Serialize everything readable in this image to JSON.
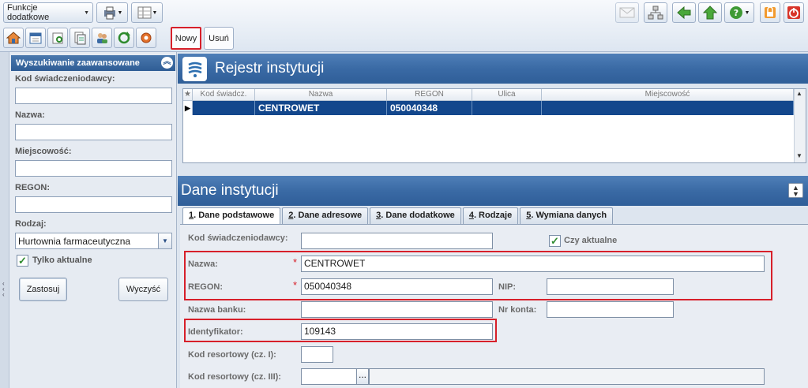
{
  "toolbar": {
    "functions_label": "Funkcje dodatkowe",
    "new_label": "Nowy",
    "delete_label": "Usuń"
  },
  "search": {
    "header": "Wyszukiwanie zaawansowane",
    "provider_code_label": "Kod świadczeniodawcy:",
    "provider_code_value": "",
    "name_label": "Nazwa:",
    "name_value": "",
    "city_label": "Miejscowość:",
    "city_value": "",
    "regon_label": "REGON:",
    "regon_value": "",
    "type_label": "Rodzaj:",
    "type_value": "Hurtownia farmaceutyczna",
    "active_only_label": "Tylko aktualne",
    "active_only_checked": true,
    "apply_label": "Zastosuj",
    "clear_label": "Wyczyść"
  },
  "registry": {
    "title": "Rejestr instytucji",
    "columns": [
      "Kod świadcz.",
      "Nazwa",
      "REGON",
      "Ulica",
      "Miejscowość"
    ],
    "rows": [
      {
        "code": "",
        "name": "CENTROWET",
        "regon": "050040348",
        "street": "",
        "city": ""
      }
    ]
  },
  "details": {
    "title": "Dane instytucji",
    "tabs": [
      {
        "num": "1",
        "label": ". Dane podstawowe"
      },
      {
        "num": "2",
        "label": ". Dane adresowe"
      },
      {
        "num": "3",
        "label": ". Dane dodatkowe"
      },
      {
        "num": "4",
        "label": ". Rodzaje"
      },
      {
        "num": "5",
        "label": ". Wymiana danych"
      }
    ],
    "provider_code_label": "Kod świadczeniodawcy:",
    "provider_code_value": "",
    "current_label": "Czy aktualne",
    "current_checked": true,
    "name_label": "Nazwa:",
    "name_value": "CENTROWET",
    "regon_label": "REGON:",
    "regon_value": "050040348",
    "nip_label": "NIP:",
    "nip_value": "",
    "bank_label": "Nazwa banku:",
    "bank_value": "",
    "account_label": "Nr konta:",
    "account_value": "",
    "identifier_label": "Identyfikator:",
    "identifier_value": "109143",
    "resort1_label": "Kod resortowy (cz. I):",
    "resort1_value": "",
    "resort3_label": "Kod resortowy (cz. III):",
    "resort3_value": "",
    "resort3_button": "...",
    "required_mark": "*"
  },
  "colors": {
    "highlight": "#d7202a",
    "header_blue": "#2f5e98",
    "selected_row": "#13478c"
  }
}
